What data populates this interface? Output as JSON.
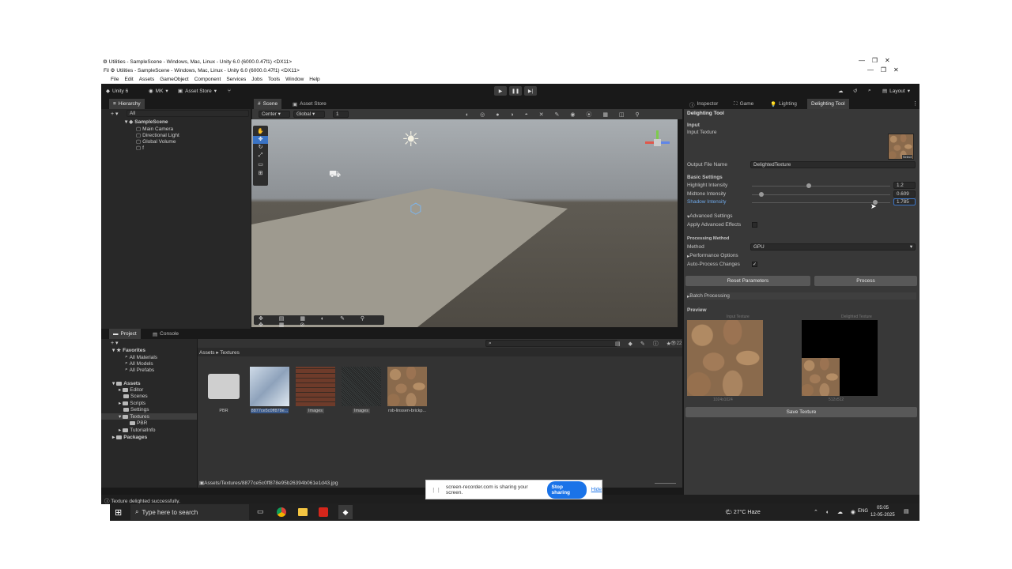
{
  "windows_title_back": "Utilities - SampleScene - Windows, Mac, Linux - Unity 6.0 (6000.0.47f1) <DX11>",
  "windows_title_front": "Utilities - SampleScene - Windows, Mac, Linux - Unity 6.0 (6000.0.47f1) <DX11>",
  "menu": [
    "File",
    "Edit",
    "Assets",
    "GameObject",
    "Component",
    "Services",
    "Jobs",
    "Tools",
    "Window",
    "Help"
  ],
  "toolbar": {
    "unity_label": "Unity 6",
    "account": "MK",
    "asset_store": "Asset Store",
    "layout": "Layout"
  },
  "hierarchy": {
    "tab": "Hierarchy",
    "search_placeholder": "All",
    "scene": "SampleScene",
    "items": [
      "Main Camera",
      "Directional Light",
      "Global Volume",
      "f"
    ]
  },
  "scene_tabs": {
    "scene": "Scene",
    "asset_store": "Asset Store"
  },
  "scene_toolbar": {
    "pivot": "Center",
    "space": "Global",
    "grid": "1"
  },
  "inspector_tabs": [
    "Inspector",
    "Game",
    "Lighting",
    "Delighting Tool"
  ],
  "delight": {
    "title": "Delighting Tool",
    "input_header": "Input",
    "input_texture_label": "Input Texture",
    "select_label": "Select",
    "output_label": "Output File Name",
    "output_value": "DelightedTexture",
    "basic_header": "Basic Settings",
    "highlight_label": "Highlight Intensity",
    "highlight_value": "1.2",
    "highlight_fraction": 0.41,
    "midtone_label": "Midtone Intensity",
    "midtone_value": "0.609",
    "midtone_fraction": 0.07,
    "shadow_label": "Shadow Intensity",
    "shadow_value": "1.785",
    "shadow_fraction": 0.89,
    "advanced_label": "Advanced Settings",
    "apply_advanced_label": "Apply Advanced Effects",
    "processing_header": "Processing Method",
    "method_label": "Method",
    "method_value": "GPU",
    "performance_label": "Performance Options",
    "auto_process_label": "Auto-Process Changes",
    "reset_button": "Reset Parameters",
    "process_button": "Process",
    "batch_label": "Batch Processing",
    "preview_header": "Preview",
    "input_preview_label": "Input Texture",
    "delighted_preview_label": "Delighted Texture",
    "input_size": "1024x1024",
    "delighted_size": "512x512",
    "save_button": "Save Texture"
  },
  "project": {
    "tab_project": "Project",
    "tab_console": "Console",
    "favorites": "Favorites",
    "fav_items": [
      "All Materials",
      "All Models",
      "All Prefabs"
    ],
    "assets": "Assets",
    "asset_folders": [
      "Editor",
      "Scenes",
      "Scripts",
      "Settings",
      "Textures"
    ],
    "pbr": "PBR",
    "tutorial": "TutorialInfo",
    "packages": "Packages",
    "breadcrumb_root": "Assets",
    "breadcrumb_leaf": "Textures",
    "count": "22",
    "files": [
      "PBR",
      "8877ce5c0ff878e...",
      "Images",
      "Images",
      "rob-linssen-brickp..."
    ],
    "selected_path": "Assets/Textures/8877ce5c0ff878e95b26394b061e1d43.jpg"
  },
  "status": "Texture delighted successfully.",
  "share": {
    "text": "screen-recorder.com is sharing your screen.",
    "stop": "Stop sharing",
    "hide": "Hide"
  },
  "taskbar": {
    "search_placeholder": "Type here to search",
    "weather": "27°C  Haze",
    "lang": "ENG",
    "time": "05:05",
    "date": "12-05-2025"
  }
}
